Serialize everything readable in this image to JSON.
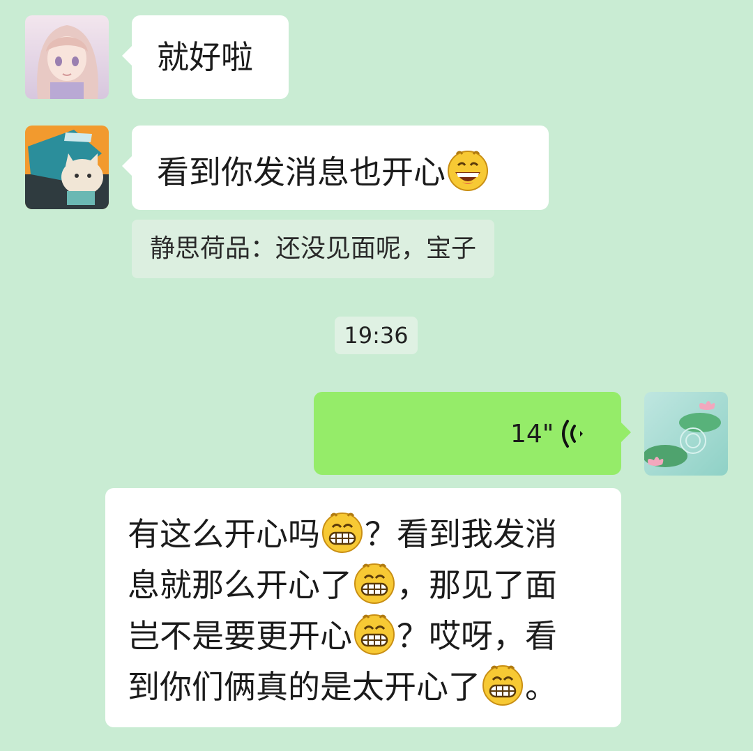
{
  "messages": {
    "m1": {
      "text": "就好啦"
    },
    "m2": {
      "text": "看到你发消息也开心",
      "emoji": "grinning-emoji"
    },
    "m2_quote": {
      "text": "静思荷品：还没见面呢，宝子"
    },
    "timestamp": "19:36",
    "m3_voice": {
      "duration": "14\"",
      "icon": "voice-wave-icon"
    },
    "m4": {
      "lines": [
        {
          "parts": [
            "有这么开心吗",
            "？看到我发消"
          ]
        },
        {
          "parts": [
            "息就那么开心了",
            "，那见了面"
          ]
        },
        {
          "parts": [
            "岂不是要更开心",
            "？哎呀，看"
          ]
        },
        {
          "parts": [
            "到你们俩真的是太开心了",
            "。"
          ]
        }
      ],
      "emoji": "beaming-emoji"
    }
  },
  "avatars": {
    "top": "anime-girl-avatar",
    "middle": "cat-avatar",
    "self": "lotus-pond-avatar"
  },
  "colors": {
    "background": "#c9ecd3",
    "bubble_white": "#ffffff",
    "bubble_green": "#95ec69",
    "quote_bg": "#dcefe0"
  }
}
